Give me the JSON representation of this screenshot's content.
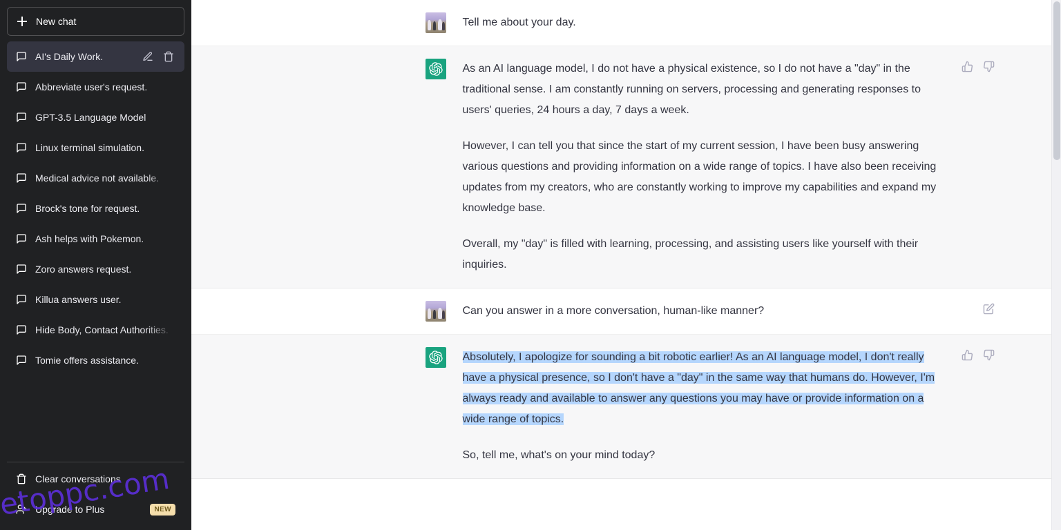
{
  "sidebar": {
    "new_chat_label": "New chat",
    "new_chat_icon": "plus-icon",
    "conversations": [
      {
        "label": "AI's Daily Work.",
        "icon": "chat-bubble-icon",
        "active": true
      },
      {
        "label": "Abbreviate user's request.",
        "icon": "chat-bubble-icon",
        "active": false
      },
      {
        "label": "GPT-3.5 Language Model",
        "icon": "chat-bubble-icon",
        "active": false
      },
      {
        "label": "Linux terminal simulation.",
        "icon": "chat-bubble-icon",
        "active": false
      },
      {
        "label": "Medical advice not available.",
        "icon": "chat-bubble-icon",
        "active": false
      },
      {
        "label": "Brock's tone for request.",
        "icon": "chat-bubble-icon",
        "active": false
      },
      {
        "label": "Ash helps with Pokemon.",
        "icon": "chat-bubble-icon",
        "active": false
      },
      {
        "label": "Zoro answers request.",
        "icon": "chat-bubble-icon",
        "active": false
      },
      {
        "label": "Killua answers user.",
        "icon": "chat-bubble-icon",
        "active": false
      },
      {
        "label": "Hide Body, Contact Authorities.",
        "icon": "chat-bubble-icon",
        "active": false
      },
      {
        "label": "Tomie offers assistance.",
        "icon": "chat-bubble-icon",
        "active": false
      }
    ],
    "active_item_actions": {
      "edit_label": "Rename chat",
      "edit_icon": "pencil-icon",
      "delete_label": "Delete chat",
      "delete_icon": "trash-icon"
    },
    "clear_conversations": {
      "label": "Clear conversations",
      "icon": "trash-icon"
    },
    "upgrade": {
      "label": "Upgrade to Plus",
      "icon": "user-plus-icon",
      "badge": "NEW"
    },
    "colors": {
      "background": "#202123",
      "active_item": "#343541",
      "text": "#ececf1",
      "badge_background": "#f5deac",
      "badge_text": "#6f5b1e"
    }
  },
  "watermark": {
    "text": "etoppc.com",
    "color": "#5b2fd6"
  },
  "thread": {
    "messages": [
      {
        "role": "user",
        "avatar_name": "user-avatar",
        "paragraphs": [
          {
            "text": "Tell me about your day."
          }
        ],
        "actions": []
      },
      {
        "role": "assistant",
        "avatar_name": "chatgpt-avatar",
        "paragraphs": [
          {
            "text": "As an AI language model, I do not have a physical existence, so I do not have a \"day\" in the traditional sense. I am constantly running on servers, processing and generating responses to users' queries, 24 hours a day, 7 days a week."
          },
          {
            "text": "However, I can tell you that since the start of my current session, I have been busy answering various questions and providing information on a wide range of topics. I have also been receiving updates from my creators, who are constantly working to improve my capabilities and expand my knowledge base."
          },
          {
            "text": "Overall, my \"day\" is filled with learning, processing, and assisting users like yourself with their inquiries."
          }
        ],
        "actions": [
          {
            "name": "thumbs-up-icon",
            "label": "Good response"
          },
          {
            "name": "thumbs-down-icon",
            "label": "Bad response"
          }
        ]
      },
      {
        "role": "user",
        "avatar_name": "user-avatar",
        "paragraphs": [
          {
            "text": "Can you answer in a more conversation, human-like manner?"
          }
        ],
        "actions": [
          {
            "name": "edit-icon",
            "label": "Edit message"
          }
        ]
      },
      {
        "role": "assistant",
        "avatar_name": "chatgpt-avatar",
        "paragraphs": [
          {
            "text": "Absolutely, I apologize for sounding a bit robotic earlier! As an AI language model, I don't really have a physical presence, so I don't have a \"day\" in the same way that humans do. However, I'm always ready and available to answer any questions you may have or provide information on a wide range of topics.",
            "selected": true
          },
          {
            "text": "So, tell me, what's on your mind today?",
            "selected": false
          }
        ],
        "actions": [
          {
            "name": "thumbs-up-icon",
            "label": "Good response"
          },
          {
            "name": "thumbs-down-icon",
            "label": "Bad response"
          }
        ]
      }
    ],
    "colors": {
      "user_background": "#ffffff",
      "assistant_background": "#f7f7f8",
      "text": "#343541",
      "selection_highlight": "#b5d6fd",
      "chatgpt_avatar": "#19a37f"
    }
  }
}
